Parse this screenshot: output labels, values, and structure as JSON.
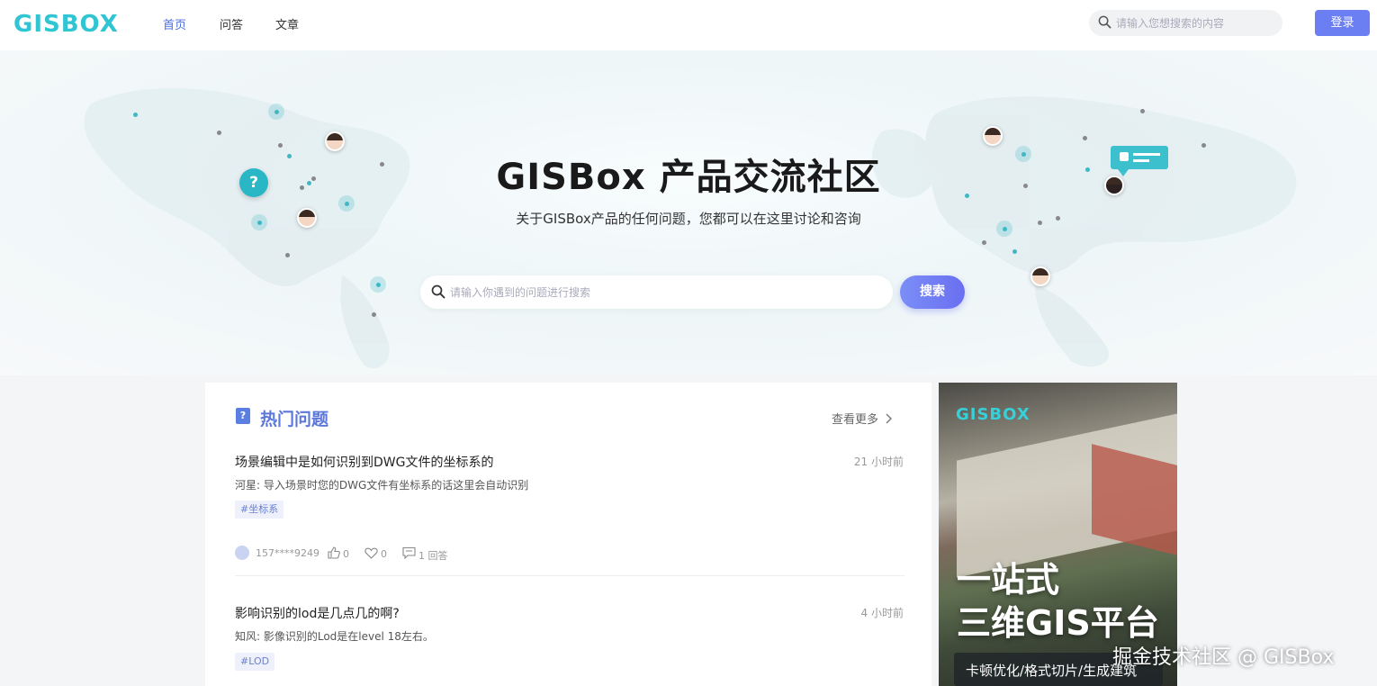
{
  "header": {
    "logo": "GISBOX",
    "nav": [
      {
        "label": "首页",
        "active": true
      },
      {
        "label": "问答",
        "active": false
      },
      {
        "label": "文章",
        "active": false
      }
    ],
    "search_placeholder": "请输入您想搜索的内容",
    "login_label": "登录"
  },
  "hero": {
    "title": "GISBox 产品交流社区",
    "subtitle": "关于GISBox产品的任何问题，您都可以在这里讨论和咨询",
    "search_placeholder": "请输入你遇到的问题进行搜索",
    "search_button": "搜索",
    "question_mark": "?"
  },
  "hot": {
    "title": "热门问题",
    "more_label": "查看更多",
    "icon_char": "?",
    "questions": [
      {
        "title": "场景编辑中是如何识别到DWG文件的坐标系的",
        "time": "21 小时前",
        "answer": "河星: 导入场景时您的DWG文件有坐标系的话这里会自动识别",
        "tag": "#坐标系",
        "user": "157****9249",
        "likes": "0",
        "favorites": "0",
        "replies": "1 回答"
      },
      {
        "title": "影响识别的lod是几点几的啊?",
        "time": "4 小时前",
        "answer": "知风: 影像识别的Lod是在level 18左右。",
        "tag": "#LOD"
      }
    ]
  },
  "ad": {
    "logo": "GISBOX",
    "headline_1": "一站式",
    "headline_2": "三维GIS平台",
    "caption": "卡顿优化/格式切片/生成建筑"
  },
  "watermark": "掘金技术社区 @ GISBox",
  "colors": {
    "accent": "#6b7ff2",
    "brand_cyan": "#2fc5d3",
    "nav_active": "#4a6ee0"
  }
}
